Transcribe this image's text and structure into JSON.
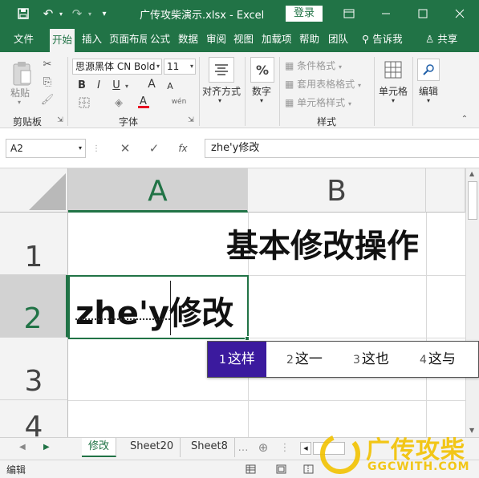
{
  "window": {
    "title": "广传攻柴演示.xlsx  -  Excel",
    "login_label": "登录",
    "accent_color": "#217346"
  },
  "tabs": [
    "文件",
    "开始",
    "插入",
    "页面布局",
    "公式",
    "数据",
    "审阅",
    "视图",
    "加载项",
    "帮助",
    "团队"
  ],
  "tell_me": "告诉我",
  "share_label": "共享",
  "ribbon": {
    "clipboard": {
      "paste_label": "粘贴",
      "group_label": "剪贴板"
    },
    "font": {
      "font_name": "思源黑体 CN Bold",
      "font_size": "11",
      "bold": "B",
      "italic": "I",
      "underline": "U",
      "grow": "A",
      "shrink": "A",
      "group_label": "字体"
    },
    "alignment": {
      "label": "对齐方式"
    },
    "number": {
      "label": "数字"
    },
    "styles": {
      "conditional": "条件格式",
      "table_format": "套用表格格式",
      "cell_styles": "单元格样式",
      "group_label": "样式"
    },
    "cells": {
      "label": "单元格"
    },
    "editing": {
      "label": "编辑"
    }
  },
  "formula_bar": {
    "name_box": "A2",
    "fx": "fx",
    "content": "zhe'y修改"
  },
  "grid": {
    "columns": [
      "A",
      "B"
    ],
    "rows": [
      "1",
      "2",
      "3",
      "4"
    ],
    "b1": "基本修改操作",
    "a2_pinyin": "zhe'y",
    "a2_text": "修改"
  },
  "ime": {
    "candidates": [
      {
        "num": "1",
        "text": "这样"
      },
      {
        "num": "2",
        "text": "这一"
      },
      {
        "num": "3",
        "text": "这也"
      },
      {
        "num": "4",
        "text": "这与"
      }
    ],
    "selected_color": "#3b1a9e"
  },
  "sheets": [
    "修改",
    "Sheet20",
    "Sheet8"
  ],
  "status": {
    "mode": "编辑"
  },
  "watermark": {
    "text": "广传攻柴",
    "url": "GGCWITH.COM"
  }
}
